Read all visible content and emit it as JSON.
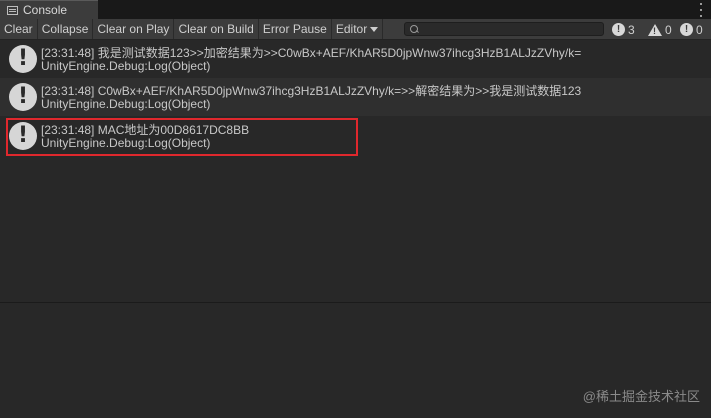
{
  "tab": {
    "label": "Console",
    "icon": "console-icon"
  },
  "toolbar": {
    "buttons": {
      "clear": "Clear",
      "collapse": "Collapse",
      "clear_on_play": "Clear on Play",
      "clear_on_build": "Clear on Build",
      "error_pause": "Error Pause",
      "editor": "Editor"
    },
    "search": {
      "value": "",
      "placeholder": ""
    },
    "counts": {
      "info": "3",
      "warnings": "0",
      "errors": "0"
    }
  },
  "logs": [
    {
      "line1": "[23:31:48] 我是测试数据123>>加密结果为>>C0wBx+AEF/KhAR5D0jpWnw37ihcg3HzB1ALJzZVhy/k=",
      "line2": "UnityEngine.Debug:Log(Object)"
    },
    {
      "line1": "[23:31:48] C0wBx+AEF/KhAR5D0jpWnw37ihcg3HzB1ALJzZVhy/k=>>解密结果为>>我是测试数据123",
      "line2": "UnityEngine.Debug:Log(Object)"
    },
    {
      "line1": "[23:31:48] MAC地址为00D8617DC8BB",
      "line2": "UnityEngine.Debug:Log(Object)"
    }
  ],
  "watermark": "@稀土掘金技术社区",
  "colors": {
    "highlight_border": "#e0282d",
    "background": "#282828",
    "toolbar": "#3c3c3c"
  }
}
